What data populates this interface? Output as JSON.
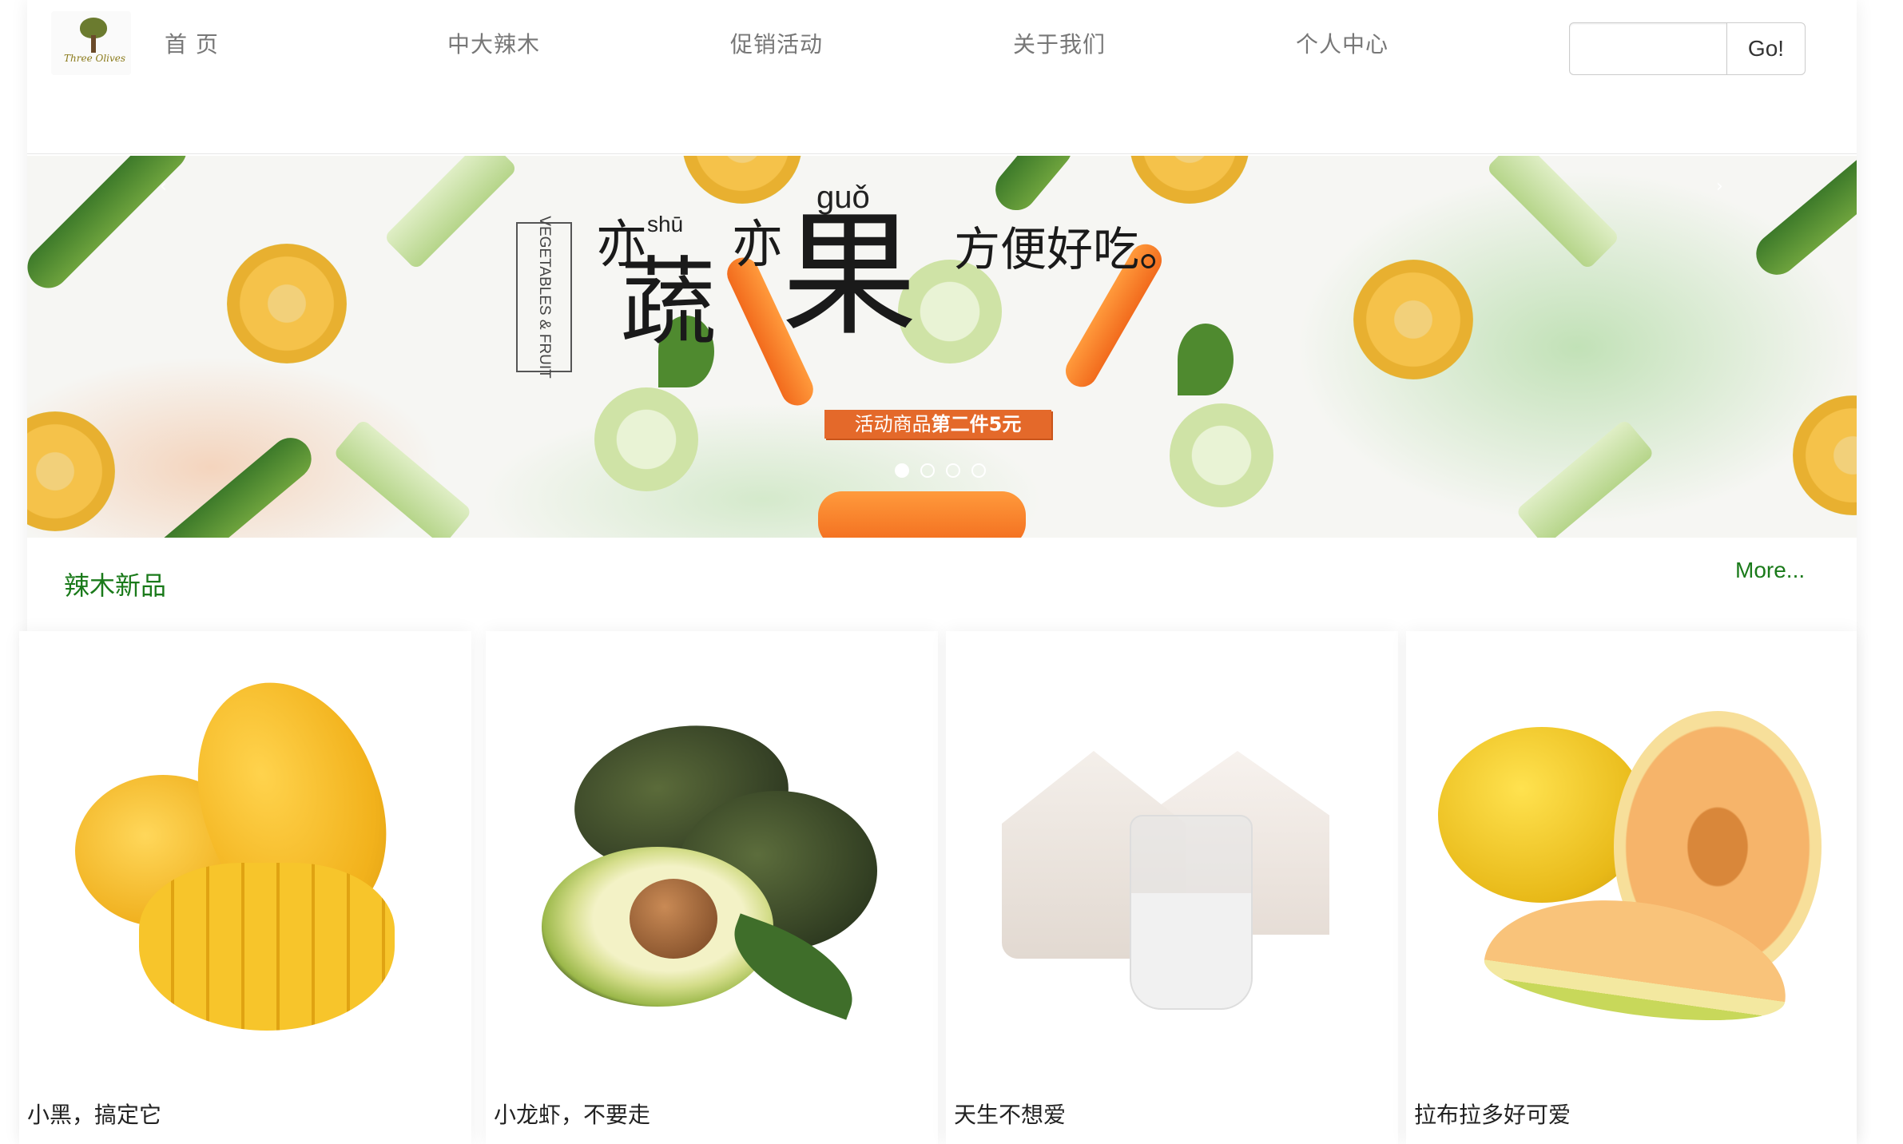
{
  "header": {
    "logo_text": "Three Olives",
    "nav": [
      "首 页",
      "中大辣木",
      "促销活动",
      "关于我们",
      "个人中心"
    ],
    "search": {
      "placeholder": "",
      "value": "",
      "button_label": "Go!"
    }
  },
  "banner": {
    "vertical_label": "VEGETABLES & FRUIT",
    "slogan": {
      "yi1": "亦",
      "shu": "蔬",
      "shu_pinyin": "shū",
      "yi2": "亦",
      "guo": "果",
      "guo_pinyin": "guǒ",
      "tail": "方便好吃。"
    },
    "promo_prefix": "活动商品",
    "promo_highlight": "第二件5元",
    "prev_arrow": "‹",
    "next_arrow": "›",
    "slides_total": 4,
    "active_slide": 1
  },
  "section": {
    "title": "辣木新品",
    "more_label": "More..."
  },
  "products": [
    {
      "name": "小黑，搞定它",
      "icon": "mango-image"
    },
    {
      "name": "小龙虾，不要走",
      "icon": "avocado-image"
    },
    {
      "name": "天生不想爱",
      "icon": "coconut-image"
    },
    {
      "name": "拉布拉多好可爱",
      "icon": "melon-image"
    }
  ],
  "colors": {
    "accent_green": "#1a7a1a",
    "promo_orange": "#e4692a"
  }
}
